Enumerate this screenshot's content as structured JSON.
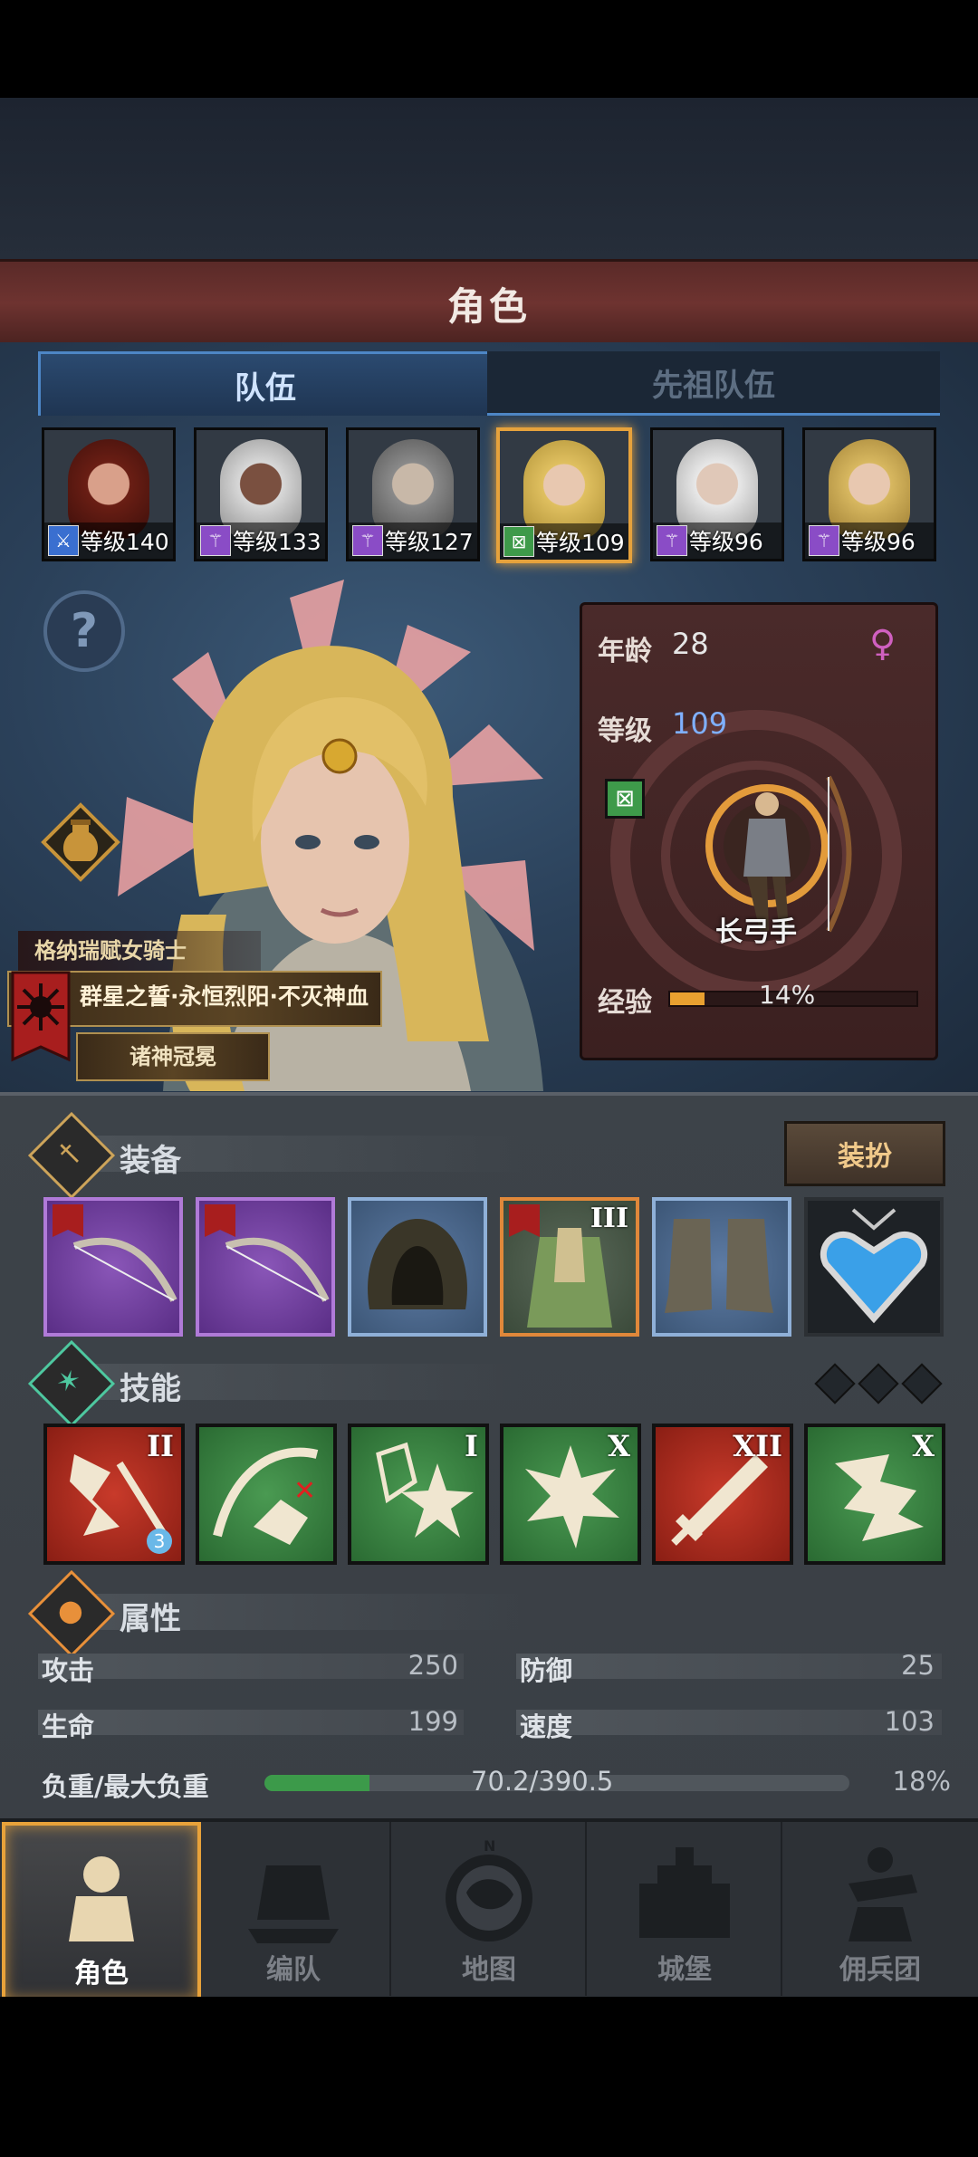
{
  "header": {
    "title": "角色"
  },
  "tabs": [
    {
      "label": "队伍",
      "active": true
    },
    {
      "label": "先祖队伍",
      "active": false
    }
  ],
  "heroes": [
    {
      "level_text": "等级140",
      "class_icon": "sword-icon",
      "class_color": "#3a6fd0",
      "selected": false
    },
    {
      "level_text": "等级133",
      "class_icon": "staff-icon",
      "class_color": "#8a4cc6",
      "selected": false
    },
    {
      "level_text": "等级127",
      "class_icon": "staff-icon",
      "class_color": "#8a4cc6",
      "selected": false
    },
    {
      "level_text": "等级109",
      "class_icon": "bow-icon",
      "class_color": "#3e9a4a",
      "selected": true
    },
    {
      "level_text": "等级96",
      "class_icon": "staff-icon",
      "class_color": "#8a4cc6",
      "selected": false
    },
    {
      "level_text": "等级96",
      "class_icon": "staff-icon",
      "class_color": "#8a4cc6",
      "selected": false
    }
  ],
  "character": {
    "age_label": "年龄",
    "age": "28",
    "level_label": "等级",
    "level": "109",
    "gender_icon": "female-icon",
    "class_name": "长弓手",
    "exp_label": "经验",
    "exp_text": "14%",
    "exp_fraction": 0.14,
    "title_small": "格纳瑞赋女骑士",
    "title_banner": "群星之誓·永恒烈阳·不灭神血",
    "subtitle": "诸神冠冕"
  },
  "equipment": {
    "title": "装备",
    "dress_button": "装扮",
    "items": [
      {
        "name": "longbow",
        "rarity": "purple",
        "rank": ""
      },
      {
        "name": "longbow",
        "rarity": "purple",
        "rank": ""
      },
      {
        "name": "hood",
        "rarity": "blue",
        "rank": ""
      },
      {
        "name": "armor",
        "rarity": "orange",
        "rank": "III"
      },
      {
        "name": "boots",
        "rarity": "blue",
        "rank": ""
      },
      {
        "name": "amulet",
        "rarity": "dark",
        "rank": ""
      }
    ]
  },
  "skills": {
    "title": "技能",
    "items": [
      {
        "color": "red",
        "rank": "II",
        "badge": "3"
      },
      {
        "color": "green",
        "rank": "",
        "badge": ""
      },
      {
        "color": "green",
        "rank": "I",
        "badge": ""
      },
      {
        "color": "green",
        "rank": "X",
        "badge": ""
      },
      {
        "color": "red",
        "rank": "XII",
        "badge": ""
      },
      {
        "color": "green",
        "rank": "X",
        "badge": ""
      }
    ]
  },
  "attributes": {
    "title": "属性",
    "attack_label": "攻击",
    "attack": "250",
    "defense_label": "防御",
    "defense": "25",
    "hp_label": "生命",
    "hp": "199",
    "speed_label": "速度",
    "speed": "103",
    "load_label": "负重/最大负重",
    "load": "70.2/390.5",
    "load_percent": "18%",
    "load_fraction": 0.18
  },
  "nav": [
    {
      "label": "角色",
      "active": true
    },
    {
      "label": "编队",
      "active": false
    },
    {
      "label": "地图",
      "active": false
    },
    {
      "label": "城堡",
      "active": false
    },
    {
      "label": "佣兵团",
      "active": false
    }
  ],
  "colors": {
    "accent": "#e6a23c",
    "tab_blue": "#4d86c6",
    "exp": "#e8a030",
    "load": "#3c9a4a"
  }
}
